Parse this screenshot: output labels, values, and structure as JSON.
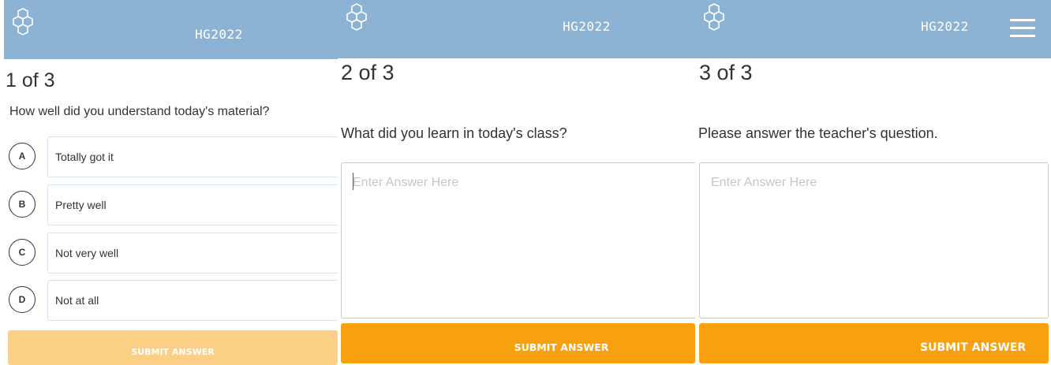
{
  "colors": {
    "header": "#8db3d4",
    "accent": "#f9a00f",
    "accent_disabled": "#fccf86"
  },
  "brand": "HG2022",
  "panels": [
    {
      "counter": "1 of 3",
      "question": "How well did you understand today's material?",
      "choices": [
        {
          "letter": "A",
          "text": "Totally got it"
        },
        {
          "letter": "B",
          "text": "Pretty well"
        },
        {
          "letter": "C",
          "text": "Not very well"
        },
        {
          "letter": "D",
          "text": "Not at all"
        }
      ],
      "submit_label": "SUBMIT ANSWER",
      "submit_enabled": false
    },
    {
      "counter": "2 of 3",
      "question": "What did you learn in today's class?",
      "answer_placeholder": "Enter Answer Here",
      "answer_value": "",
      "submit_label": "SUBMIT ANSWER",
      "submit_enabled": true
    },
    {
      "counter": "3 of 3",
      "question": "Please answer the teacher's question.",
      "answer_placeholder": "Enter Answer Here",
      "answer_value": "",
      "submit_label": "SUBMIT ANSWER",
      "submit_enabled": true
    }
  ],
  "icons": {
    "logo": "hexagon-logo-icon",
    "menu": "hamburger-menu-icon"
  }
}
